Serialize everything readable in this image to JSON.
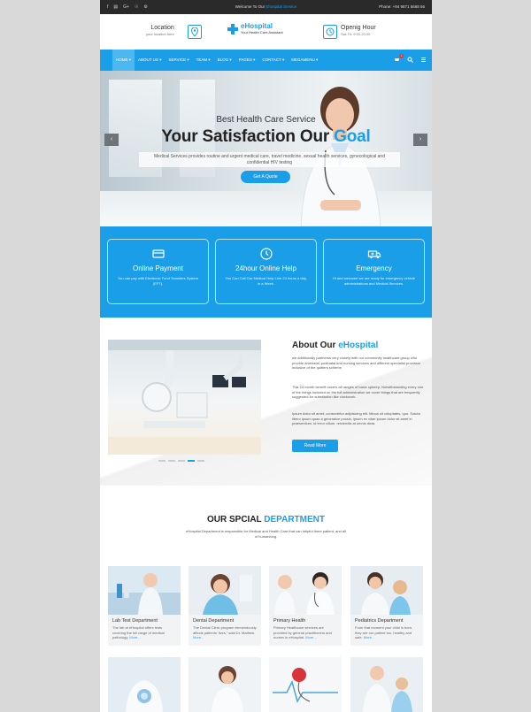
{
  "topbar": {
    "social": [
      "f",
      "▤",
      "G+",
      "☉",
      "⚙"
    ],
    "welcome_text": "Welcome To Our",
    "welcome_highlight": "Ehospital Service",
    "phone": "Phone: +94 9871 5668 56"
  },
  "header": {
    "location_title": "Location",
    "location_sub": "your location here",
    "brand_name": "eHospital",
    "brand_tagline": "Your Health Care Assistant",
    "hours_title": "Openig Hour",
    "hours_sub": "Sat-Th: 9:00-20:00"
  },
  "nav": {
    "items": [
      "HOME ▾",
      "ABOUT US ▾",
      "SERVICE ▾",
      "TEAM ▾",
      "BLOG ▾",
      "PAGES ▾",
      "CONTACT ▾",
      "MEGAMENU ▾"
    ],
    "cart_count": "1",
    "icons": [
      "cart-icon",
      "search-icon",
      "menu-icon"
    ]
  },
  "hero": {
    "subtitle": "Best Health Care Service",
    "title_main": "Your Satisfaction Our",
    "title_accent": "Goal",
    "description": "Medical Services provides routine and urgent medical care, travel medicine, sexual health services, gynecological and confidential HIV testing",
    "button": "Get A Quote",
    "prev": "‹",
    "next": "›"
  },
  "services": [
    {
      "title": "Online Payment",
      "text": "You can pay with Electronic Fund Transfers System (EFT).",
      "icon": "payment-icon"
    },
    {
      "title": "24hour Online Help",
      "text": "You Can Call Our Medical Help Line 24 hours a day, in a Week.",
      "icon": "support-icon"
    },
    {
      "title": "Emergency",
      "text": "Hi and welcome we are ready for emergency vehicle administrations and Medical Services.",
      "icon": "ambulance-icon"
    }
  ],
  "about": {
    "heading": "About Our",
    "heading_accent": "eHospital",
    "p1": "we additionally partnerss very closely with our community healthcare group who provide antenatal, postnatal and nursing services and different specialist provision inclusive of the quitters scheme.",
    "p2": "This 24 month benefit covers all ranges of basic upkeep. Notwithstanding every one of the things included on the full administration we cover things that are frequently suggested for substitution like clockwork.",
    "p3": "Ipsum dolor sit amet, consectetur adipisicing elit. Minus sit voluptates, quo. Soluta libero ipsum quas a generalice possis, ipsum ex vitae ipsum dolor sit amet in praesentium. id error cillum. reiciendis at omnis dicta.",
    "button": "Read More"
  },
  "department": {
    "heading": "OUR SPCIAL",
    "heading_accent": "DEPARTMENT",
    "intro": "eHospital Department is responsible for Medical and Health Care that can helpful three patient, and all of humanbing.",
    "cards": [
      {
        "title": "Lab Test Department",
        "text": "The lab at eHospital offers tests covering the full range of medical pathology.",
        "more": "More..."
      },
      {
        "title": "Dental Department",
        "text": "The Dental Clinic program tremendously affects patients' lives,\" said Dr. Mathew.",
        "more": "More..."
      },
      {
        "title": "Primary Health",
        "text": "Primary Healthcare services are provided by general practitioners and nurses in eHospital.",
        "more": "More..."
      },
      {
        "title": "Pediatrics Department",
        "text": "From that moment your child is born, they are our patient too, healthy and safe.",
        "more": "More..."
      }
    ]
  },
  "colors": {
    "accent": "#1b9ee8",
    "topbar": "#2a2a2a",
    "backdrop": "#d9d9d9"
  }
}
